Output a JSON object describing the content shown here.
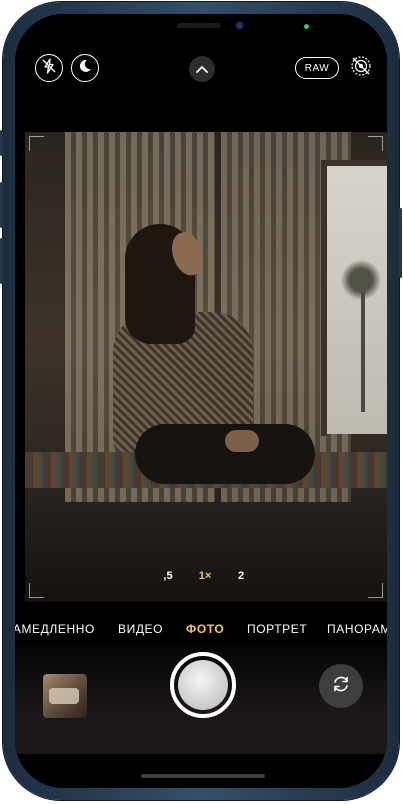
{
  "top_bar": {
    "flash_icon": "flash-off-icon",
    "night_icon": "night-mode-icon",
    "chevron_icon": "chevron-up-icon",
    "raw_label": "RAW",
    "live_icon": "live-photo-off-icon"
  },
  "zoom": {
    "options": [
      ",5",
      "1×",
      "2"
    ],
    "selected": "1×"
  },
  "modes": {
    "items": [
      "ЗАМЕДЛЕННО",
      "ВИДЕО",
      "ФОТО",
      "ПОРТРЕТ",
      "ПАНОРАМА"
    ],
    "selected": "ФОТО"
  },
  "controls": {
    "gallery_icon": "last-photo-thumbnail",
    "shutter_icon": "shutter-button",
    "switch_icon": "camera-switch-icon"
  },
  "colors": {
    "accent": "#f7c948",
    "device_frame": "#33506b"
  }
}
